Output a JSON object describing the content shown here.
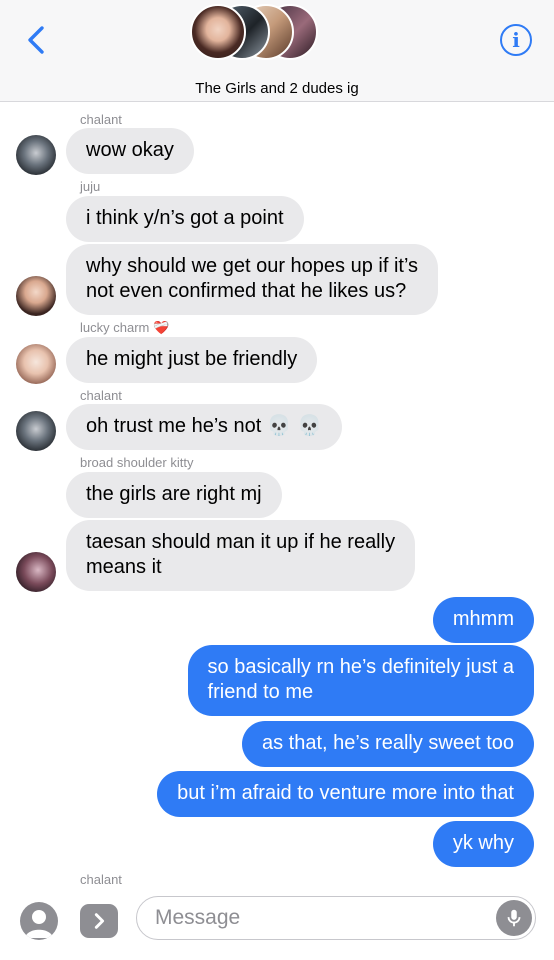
{
  "header": {
    "group_name": "The Girls and 2 dudes ig",
    "back_icon": "chevron-left-icon",
    "info_icon": "info-icon",
    "info_glyph": "i",
    "accent": "#2f7bf5"
  },
  "messages": [
    {
      "sender": "chalant",
      "text": "wow okay"
    },
    {
      "sender": "juju",
      "text": "i think y/n’s got a point"
    },
    {
      "text": "why should we get our hopes up if it’s\nnot even confirmed that he likes us?"
    },
    {
      "sender": "lucky charm ❤️‍🩹",
      "text": "he might just be friendly"
    },
    {
      "sender": "chalant",
      "text": "oh trust me he’s not 💀 💀"
    },
    {
      "sender": "broad shoulder kitty",
      "text": "the girls are right mj"
    },
    {
      "text": "taesan should man it up if he really\nmeans it"
    },
    {
      "text": "mhmm"
    },
    {
      "text": "so basically rn he’s definitely just a\nfriend to me"
    },
    {
      "text": "as that, he’s really sweet too"
    },
    {
      "text": "but i’m afraid to venture more into that"
    },
    {
      "text": "yk why"
    }
  ],
  "typing_sender": "chalant",
  "composer": {
    "placeholder": "Message",
    "camera_icon": "camera-icon",
    "apps_icon": "chevron-right-icon",
    "mic_icon": "microphone-icon"
  },
  "colors": {
    "outgoing_bubble": "#2f7bf5",
    "incoming_bubble": "#e9e9eb",
    "sender_label": "#8e8e93"
  }
}
